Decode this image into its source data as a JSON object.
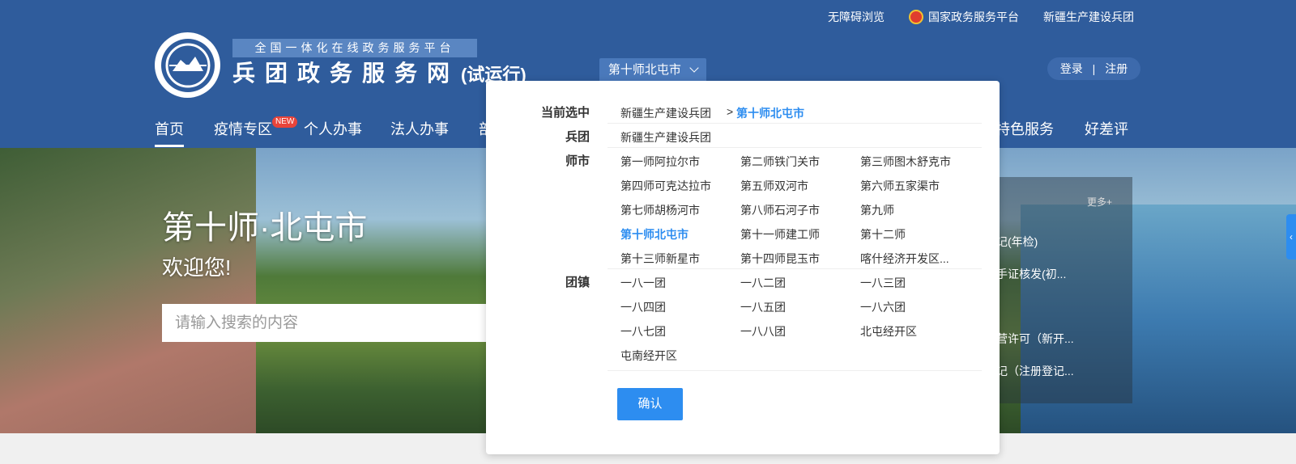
{
  "toplinks": {
    "accessible": "无障碍浏览",
    "national_platform": "国家政务服务平台",
    "corps": "新疆生产建设兵团"
  },
  "header": {
    "slogan": "全国一体化在线政务服务平台",
    "site_name": "兵团政务服务网",
    "site_suffix": "(试运行)",
    "city_selector": "第十师北屯市",
    "login": "登录",
    "separator": "|",
    "register": "注册"
  },
  "nav": {
    "items": [
      "首页",
      "疫情专区",
      "个人办事",
      "法人办事",
      "部",
      "特色服务",
      "好差评"
    ],
    "new_badge": "NEW"
  },
  "hero": {
    "title": "第十师·北屯市",
    "subtitle": "欢迎您!",
    "search_placeholder": "请输入搜索的内容"
  },
  "right_panel": {
    "more": "更多+",
    "items": [
      "记(年检)",
      "手证核发(初...",
      "营许可（新开...",
      "记（注册登记..."
    ]
  },
  "sidetab": {
    "arrow": "‹"
  },
  "dropdown": {
    "current_label": "当前选中",
    "current_path": [
      "新疆生产建设兵团",
      ">",
      "第十师北屯市"
    ],
    "corps_label": "兵团",
    "corps_items": [
      "新疆生产建设兵团"
    ],
    "city_label": "师市",
    "city_items": [
      "第一师阿拉尔市",
      "第二师铁门关市",
      "第三师图木舒克市",
      "第四师可克达拉市",
      "第五师双河市",
      "第六师五家渠市",
      "第七师胡杨河市",
      "第八师石河子市",
      "第九师",
      "第十师北屯市",
      "第十一师建工师",
      "第十二师",
      "第十三师新星市",
      "第十四师昆玉市",
      "喀什经济开发区..."
    ],
    "town_label": "团镇",
    "town_items": [
      "一八一团",
      "一八二团",
      "一八三团",
      "一八四团",
      "一八五团",
      "一八六团",
      "一八七团",
      "一八八团",
      "北屯经开区",
      "屯南经开区"
    ],
    "selected_city": "第十师北屯市",
    "confirm": "确认"
  }
}
